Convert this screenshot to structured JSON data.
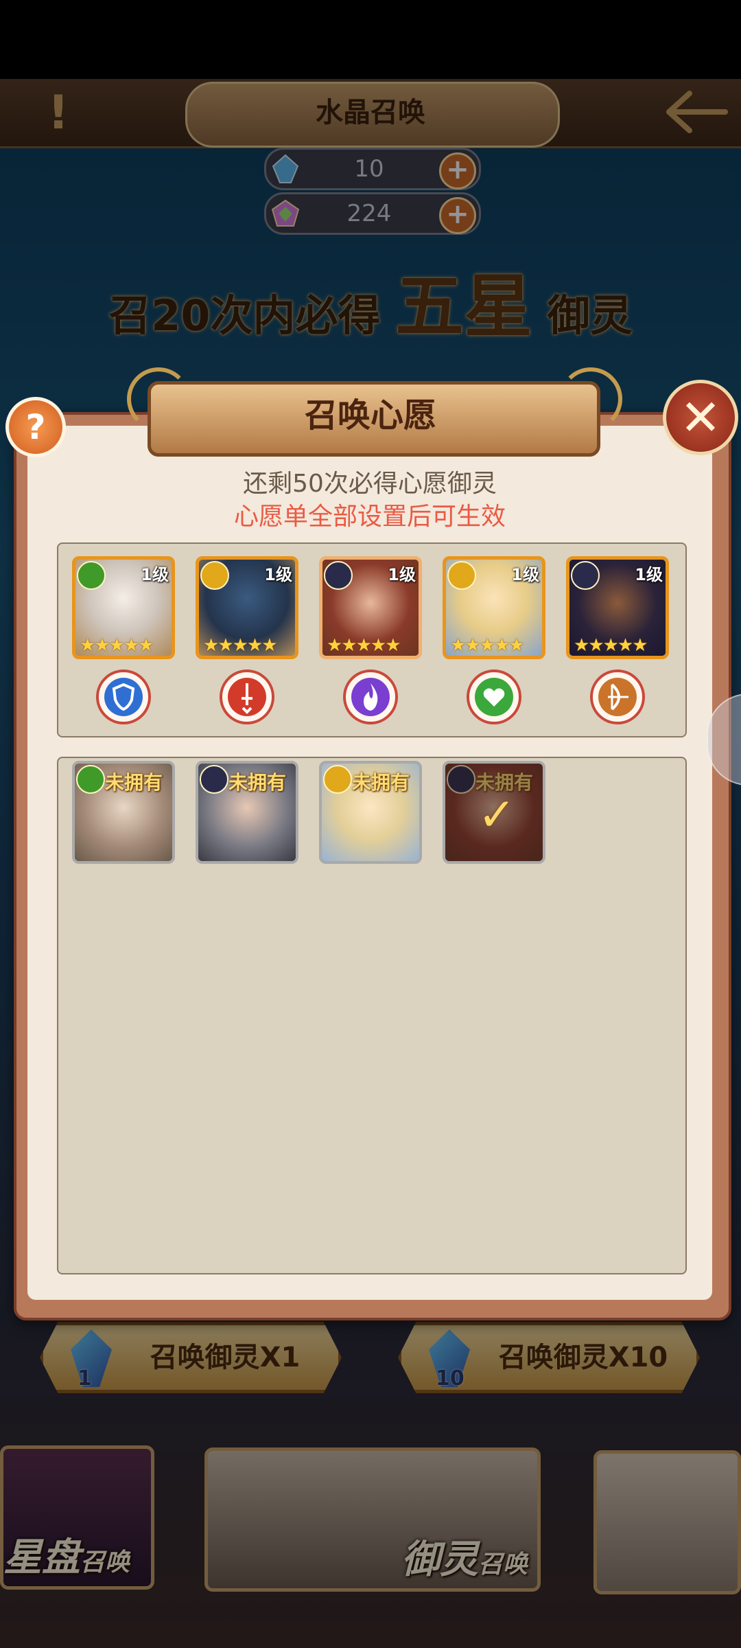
{
  "header": {
    "title": "水晶召唤"
  },
  "currency": [
    {
      "name": "crystal",
      "value": "10"
    },
    {
      "name": "rainbow-gem",
      "value": "224"
    }
  ],
  "guarantee": {
    "prefix": "召20次内必得",
    "highlight": "五星",
    "suffix": "御灵"
  },
  "dialog": {
    "title": "召唤心愿",
    "remaining": "还剩50次必得心愿御灵",
    "warning": "心愿单全部设置后可生效",
    "help": "?",
    "close": "✕"
  },
  "wishlist": [
    {
      "level": "1级",
      "stars": "★★★★★",
      "faction_color": "#3f9a2a",
      "class_icon": "shield-icon",
      "class_color": "#2f6fd3"
    },
    {
      "level": "1级",
      "stars": "★★★★★",
      "faction_color": "#e0a81a",
      "class_icon": "sword-icon",
      "class_color": "#d23b2a"
    },
    {
      "level": "1级",
      "stars": "★★★★★",
      "faction_color": "#2a2a4a",
      "class_icon": "flame-icon",
      "class_color": "#7a3ed1"
    },
    {
      "level": "1级",
      "stars": "★★★★★",
      "faction_color": "#e0a81a",
      "class_icon": "heart-icon",
      "class_color": "#3aa83a"
    },
    {
      "level": "1级",
      "stars": "★★★★★",
      "faction_color": "#2a2a4a",
      "class_icon": "bow-icon",
      "class_color": "#c9742a"
    }
  ],
  "pool": [
    {
      "status": "未拥有",
      "faction_color": "#3f9a2a",
      "selected": false
    },
    {
      "status": "未拥有",
      "faction_color": "#2a2a4a",
      "selected": false
    },
    {
      "status": "未拥有",
      "faction_color": "#e0a81a",
      "selected": false
    },
    {
      "status": "未拥有",
      "faction_color": "#2a2a4a",
      "selected": true
    }
  ],
  "summon_buttons": [
    {
      "label": "召唤御灵X1",
      "cost": "1"
    },
    {
      "label": "召唤御灵X10",
      "cost": "10"
    }
  ],
  "banners": [
    {
      "label": "星盘",
      "sub": "召唤"
    },
    {
      "label": "御灵",
      "sub": "召唤"
    }
  ],
  "colors": {
    "accent": "#e8951c",
    "warning": "#ea5a44",
    "panel": "#f3e9dc"
  }
}
